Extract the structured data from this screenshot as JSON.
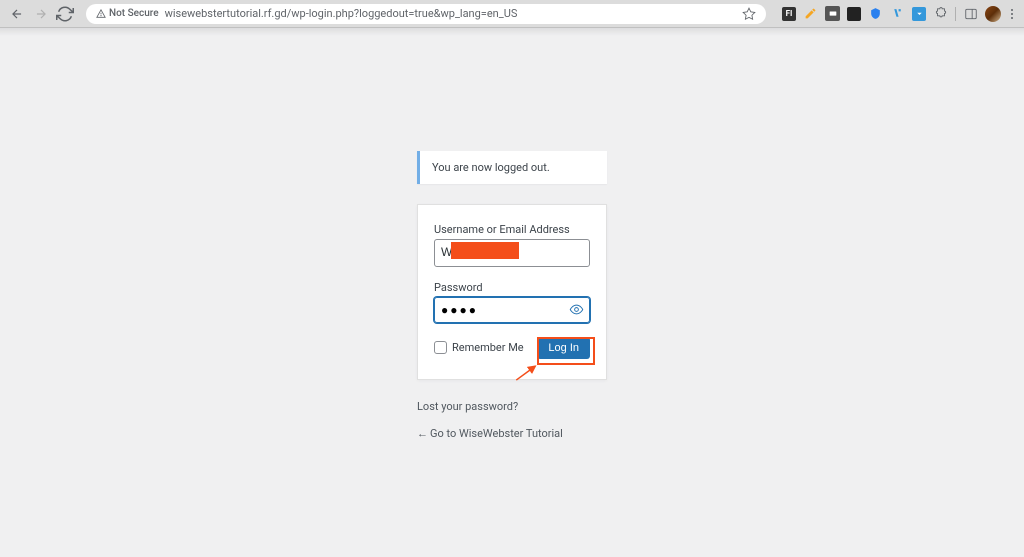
{
  "browser": {
    "not_secure_label": "Not Secure",
    "url": "wisewebstertutorial.rf.gd/wp-login.php?loggedout=true&wp_lang=en_US"
  },
  "message": {
    "text": "You are now logged out."
  },
  "form": {
    "username_label": "Username or Email Address",
    "username_value": "W",
    "password_label": "Password",
    "password_value": "●●●●",
    "remember_label": "Remember Me",
    "submit_label": "Log In"
  },
  "links": {
    "lost_password": "Lost your password?",
    "back_to_site": "Go to WiseWebster Tutorial"
  }
}
